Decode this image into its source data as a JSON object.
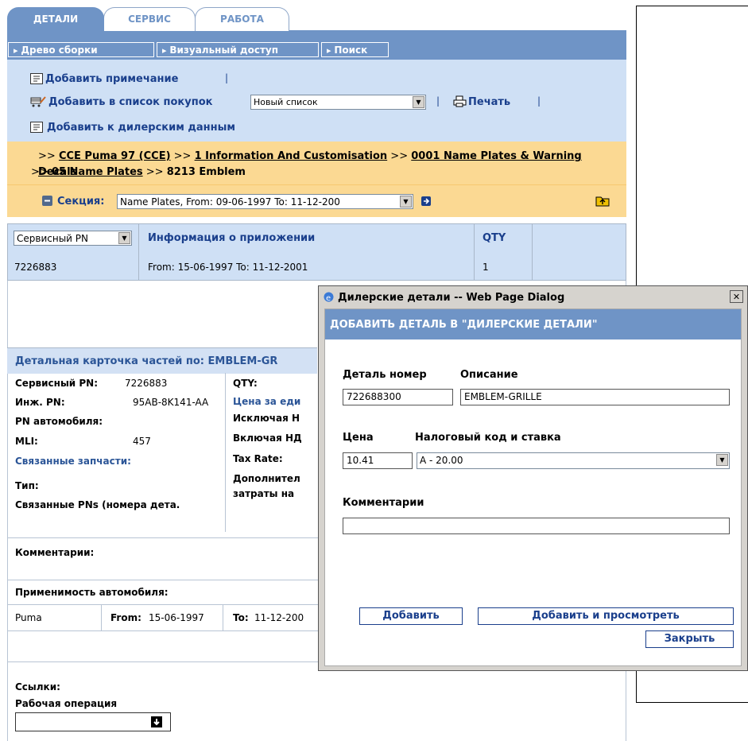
{
  "tabs": [
    {
      "label": "ДЕТАЛИ"
    },
    {
      "label": "СЕРВИС"
    },
    {
      "label": "РАБОТА"
    }
  ],
  "toolbar": {
    "buttons": [
      {
        "label": "Древо сборки"
      },
      {
        "label": "Визуальный доступ"
      },
      {
        "label": "Поиск"
      }
    ]
  },
  "actions": {
    "add_note": "Добавить примечание",
    "add_to_cart": "Добавить в список покупок",
    "list_select": "Новый список",
    "print": "Печать",
    "add_dealer": "Добавить к дилерским данным",
    "sep": "|"
  },
  "breadcrumb": {
    "prefix": ">>",
    "items": [
      "CCE Puma 97 (CCE)",
      "1 Information And Customisation",
      "0001 Name Plates & Warning Decals",
      "05 Name Plates"
    ],
    "current": "8213 Emblem"
  },
  "section": {
    "label": "Секция:",
    "value": "Name Plates, From: 09-06-1997 To: 11-12-200"
  },
  "grid": {
    "headers": [
      "Сервисный PN",
      "Информация о приложении",
      "QTY",
      ""
    ],
    "rows": [
      [
        "7226883",
        "From: 15-06-1997 To: 11-12-2001",
        "1",
        ""
      ]
    ]
  },
  "card": {
    "title": "Детальная карточка частей по: EMBLEM-GR",
    "service_pn_label": "Сервисный PN:",
    "service_pn": "7226883",
    "eng_pn_label": "Инж. PN:",
    "eng_pn": "95AB-8K141-AA",
    "vehicle_pn_label": "PN автомобиля:",
    "mli_label": "MLI:",
    "mli": "457",
    "related_label": "Связанные запчасти:",
    "type_label": "Тип:",
    "related_pns_label": "Связанные PNs (номера дета.",
    "qty_label": "QTY:",
    "price_label": "Цена за еди",
    "excl_label": "Исключая Н",
    "incl_label": "Включая НД",
    "tax_label": "Tax Rate:",
    "extra_label_1": "Дополнител",
    "extra_label_2": "затраты на",
    "comments_label": "Комментарии:",
    "applicability_label": "Применимость автомобиля:",
    "app_model": "Puma",
    "from_label": "From:",
    "from_value": "15-06-1997",
    "to_label": "To:",
    "to_value": "11-12-200",
    "links_label": "Ссылки:",
    "work_op_label": "Рабочая операция"
  },
  "dialog": {
    "title": "Дилерские детали -- Web Page Dialog",
    "close_glyph": "✕",
    "heading": "ДОБАВИТЬ ДЕТАЛЬ В \"ДИЛЕРСКИЕ ДЕТАЛИ\"",
    "part_no_label": "Деталь номер",
    "desc_label": "Описание",
    "part_no": "722688300",
    "desc": "EMBLEM-GRILLE",
    "price_label": "Цена",
    "tax_label": "Налоговый код и ставка",
    "price": "10.41",
    "tax": "A - 20.00",
    "comments_label": "Комментарии",
    "comments": "",
    "btn_add": "Добавить",
    "btn_add_view": "Добавить и просмотреть",
    "btn_close": "Закрыть"
  },
  "colors": {
    "accent": "#6f94c6",
    "actions_bg": "#cfe0f5",
    "crumb_bg": "#fbd993",
    "dialog_chrome": "#d6d3ce"
  }
}
